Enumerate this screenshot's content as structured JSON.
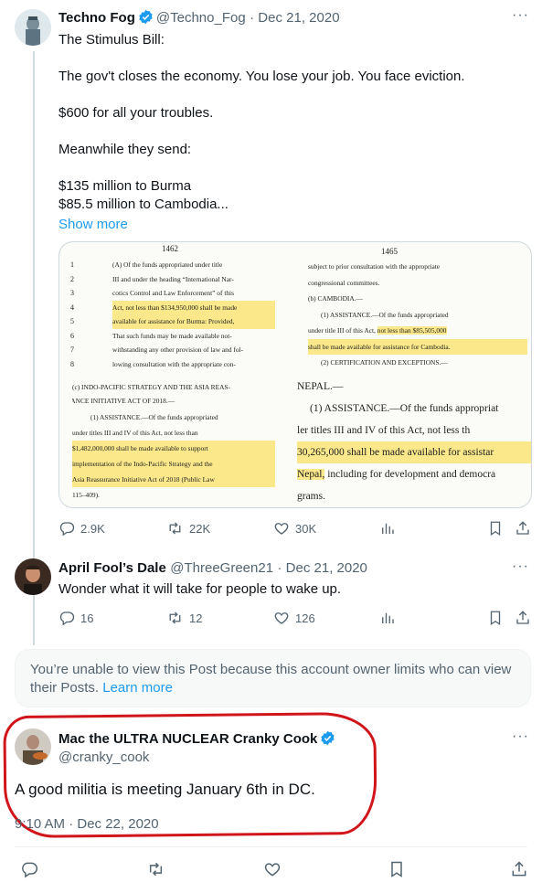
{
  "tweet1": {
    "name": "Techno Fog",
    "handle": "@Techno_Fog",
    "date": "· Dec 21, 2020",
    "lines": [
      "The Stimulus Bill:",
      "The gov't closes the economy. You lose your job. You face eviction.",
      "$600 for all your troubles.",
      "Meanwhile they send:",
      "$135 million to Burma",
      "$85.5 million to Cambodia..."
    ],
    "show_more": "Show more",
    "doc": {
      "left_page": "1462",
      "right_page": "1465",
      "left_line_nums": [
        "1",
        "2",
        "3",
        "4",
        "5",
        "6",
        "7",
        "8"
      ],
      "left_lines": [
        "(A) Of the funds appropriated under title",
        "III and under the heading “International Nar-",
        "cotics Control and Law Enforcement” of this",
        "Act, not less than $134,950,000 shall be made",
        "available for assistance for Burma: Provided,",
        "That such funds may be made available not-",
        "withstanding any other provision of law and fol-",
        "lowing consultation with the appropriate con-"
      ],
      "left_sec_head": "(c) INDO-PACIFIC STRATEGY AND THE ASIA REAS-",
      "left_sec_head2": "URANCE INITIATIVE ACT OF 2018.—",
      "left_sec_lines": [
        "(1) ASSISTANCE.—Of the funds appropriated",
        "under titles III and IV of this Act, not less than",
        "$1,482,000,000 shall be made available to support",
        "implementation of the Indo-Pacific Strategy and the",
        "Asia Reassurance Initiative Act of 2018 (Public Law",
        "115–409)."
      ],
      "right_lines": [
        "subject to prior consultation with the appropriate",
        "congressional committees.",
        "(b) CAMBODIA.—",
        "(1) ASSISTANCE.—Of the funds appropriated",
        "under title III of this Act, not less than $85,505,000",
        "shall be made available for assistance for Cambodia.",
        "(2) CERTIFICATION AND EXCEPTIONS.—"
      ],
      "right_big": [
        "NEPAL.—",
        "(1) ASSISTANCE.—Of the funds appropriat",
        "ler titles III and IV of this Act, not less th",
        "30,265,000 shall be made available for assistar",
        "Nepal, including for development and democra",
        "grams."
      ]
    },
    "actions": {
      "replies": "2.9K",
      "reposts": "22K",
      "likes": "30K"
    }
  },
  "tweet2": {
    "name": "April Fool’s Dale",
    "handle": "@ThreeGreen21",
    "date": "· Dec 21, 2020",
    "text": "Wonder what it will take for people to wake up.",
    "actions": {
      "replies": "16",
      "reposts": "12",
      "likes": "126"
    }
  },
  "notice": {
    "text": "You’re unable to view this Post because this account owner limits who can view their Posts.",
    "link": "Learn more"
  },
  "main_tweet": {
    "name": "Mac the ULTRA NUCLEAR Cranky Cook",
    "handle": "@cranky_cook",
    "text": "A good militia is meeting January 6th in DC.",
    "timestamp": "9:10 AM · Dec 22, 2020"
  },
  "colors": {
    "accent": "#1d9bf0",
    "highlight": "#fbe88a",
    "annotation": "#d0151b"
  }
}
